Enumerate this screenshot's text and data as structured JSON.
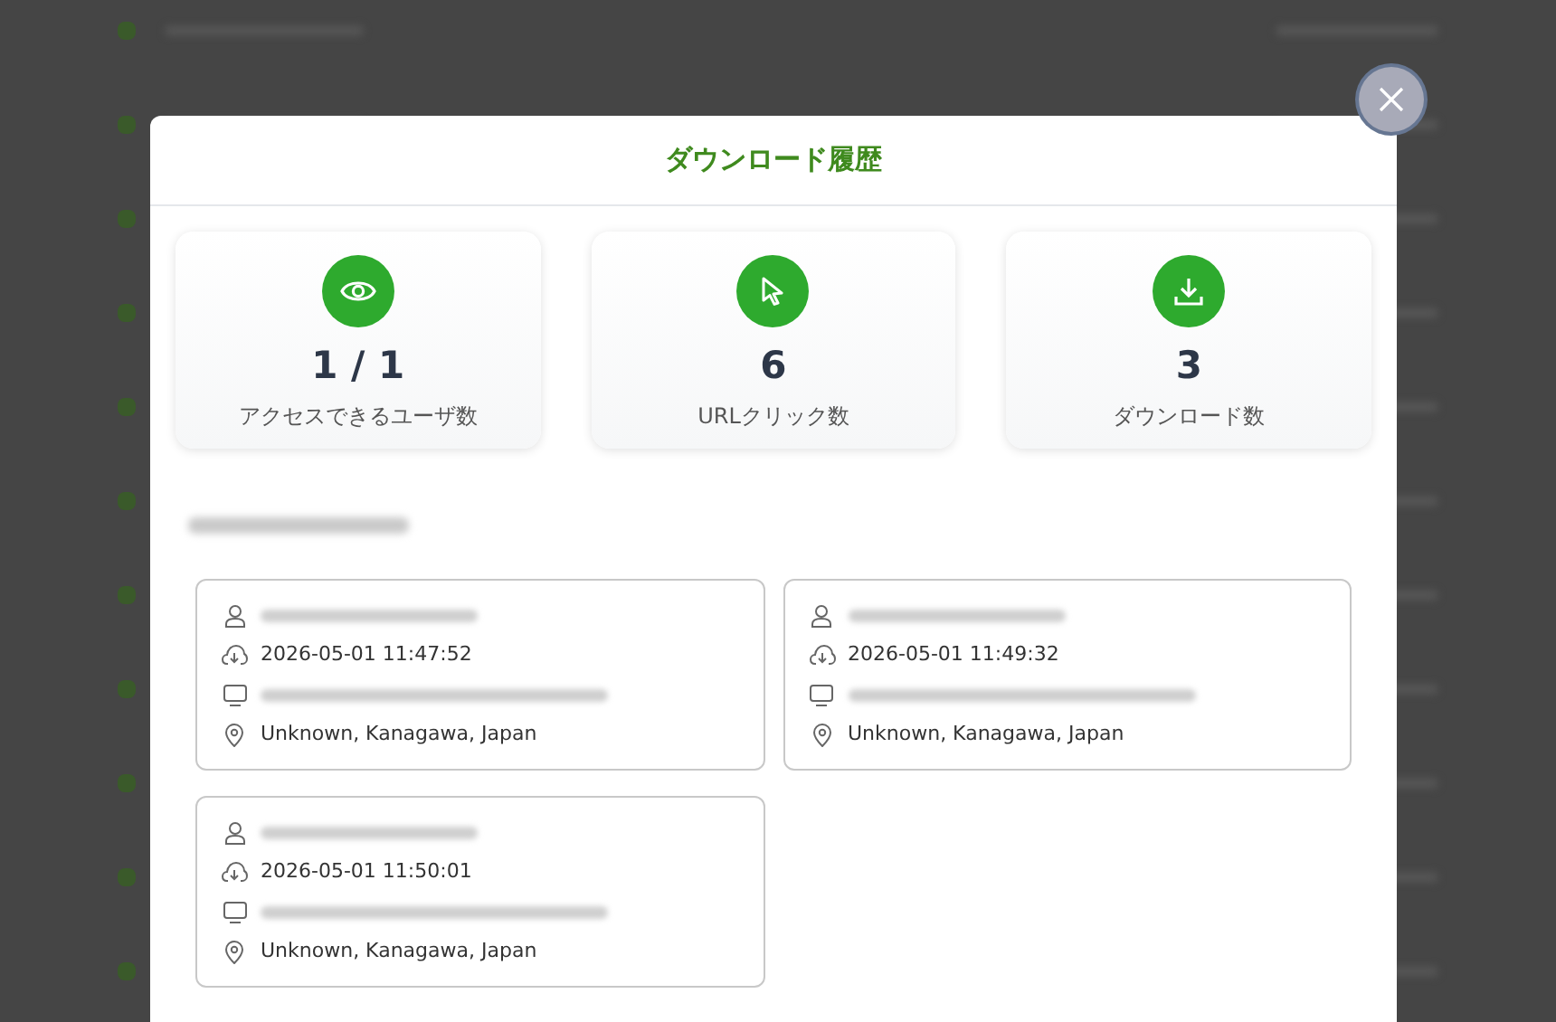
{
  "dialog": {
    "title": "ダウンロード履歴"
  },
  "stats": [
    {
      "kind": "users",
      "value": "1 / 1",
      "label": "アクセスできるユーザ数"
    },
    {
      "kind": "clicks",
      "value": "6",
      "label": "URLクリック数"
    },
    {
      "kind": "downloads",
      "value": "3",
      "label": "ダウンロード数"
    }
  ],
  "file_name": {
    "redacted": true
  },
  "entries": [
    {
      "rows": [
        {
          "kind": "user",
          "redacted": true
        },
        {
          "kind": "download",
          "text": "2026-05-01 11:47:52"
        },
        {
          "kind": "device",
          "redacted": true
        },
        {
          "kind": "location",
          "text": "Unknown, Kanagawa, Japan"
        }
      ]
    },
    {
      "rows": [
        {
          "kind": "user",
          "redacted": true
        },
        {
          "kind": "download",
          "text": "2026-05-01 11:49:32"
        },
        {
          "kind": "device",
          "redacted": true
        },
        {
          "kind": "location",
          "text": "Unknown, Kanagawa, Japan"
        }
      ]
    },
    {
      "rows": [
        {
          "kind": "user",
          "redacted": true
        },
        {
          "kind": "download",
          "text": "2026-05-01 11:50:01"
        },
        {
          "kind": "device",
          "redacted": true
        },
        {
          "kind": "location",
          "text": "Unknown, Kanagawa, Japan"
        }
      ]
    }
  ]
}
